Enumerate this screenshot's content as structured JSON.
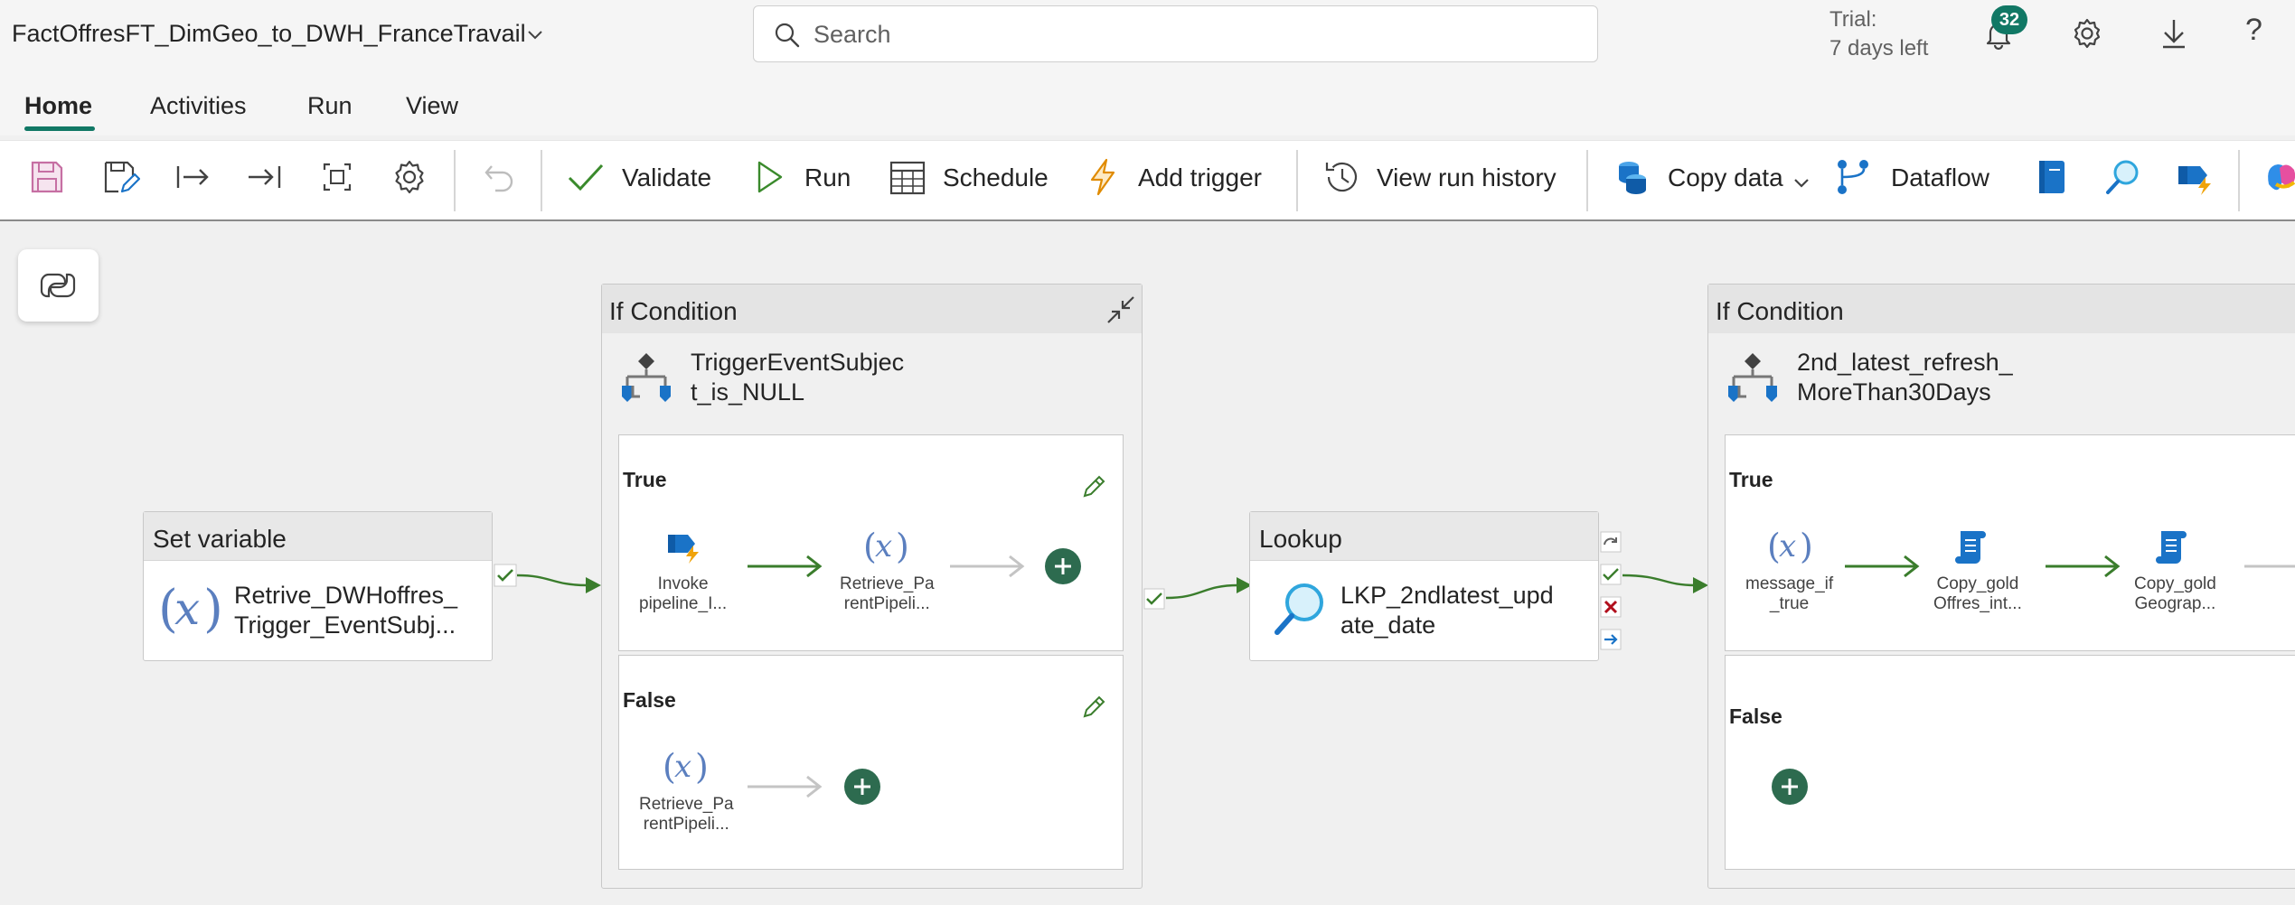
{
  "header": {
    "title": "FactOffresFT_DimGeo_to_DWH_FranceTravail",
    "search_placeholder": "Search",
    "trial_line1": "Trial:",
    "trial_line2": "7 days left",
    "notification_count": "32",
    "help_glyph": "?"
  },
  "tabs": [
    {
      "label": "Home",
      "selected": true
    },
    {
      "label": "Activities",
      "selected": false
    },
    {
      "label": "Run",
      "selected": false
    },
    {
      "label": "View",
      "selected": false
    }
  ],
  "toolbar": {
    "validate": "Validate",
    "run": "Run",
    "schedule": "Schedule",
    "add_trigger": "Add trigger",
    "view_run_history": "View run history",
    "copy_data": "Copy data",
    "dataflow": "Dataflow"
  },
  "pipeline": {
    "set_variable": {
      "type": "Set variable",
      "name_line1": "Retrive_DWHoffres_",
      "name_line2": "Trigger_EventSubj..."
    },
    "if_condition_1": {
      "type": "If Condition",
      "name_line1": "TriggerEventSubjec",
      "name_line2": "t_is_NULL",
      "true_label": "True",
      "false_label": "False",
      "true_activities": [
        {
          "line1": "Invoke",
          "line2": "pipeline_I..."
        },
        {
          "line1": "Retrieve_Pa",
          "line2": "rentPipeli..."
        }
      ],
      "false_activities": [
        {
          "line1": "Retrieve_Pa",
          "line2": "rentPipeli..."
        }
      ]
    },
    "lookup": {
      "type": "Lookup",
      "name_line1": "LKP_2ndlatest_upd",
      "name_line2": "ate_date"
    },
    "if_condition_2": {
      "type": "If Condition",
      "name_line1": "2nd_latest_refresh_",
      "name_line2": "MoreThan30Days",
      "true_label": "True",
      "false_label": "False",
      "true_activities": [
        {
          "line1": "message_if",
          "line2": "_true"
        },
        {
          "line1": "Copy_gold",
          "line2": "Offres_int..."
        },
        {
          "line1": "Copy_gold",
          "line2": "Geograp..."
        }
      ]
    }
  },
  "colors": {
    "accent": "#117865",
    "success_green": "#3a7d2c",
    "arrow_gray": "#c4c4c4",
    "expression_blue": "#5b7fbf",
    "fail_red": "#b10e1c"
  }
}
